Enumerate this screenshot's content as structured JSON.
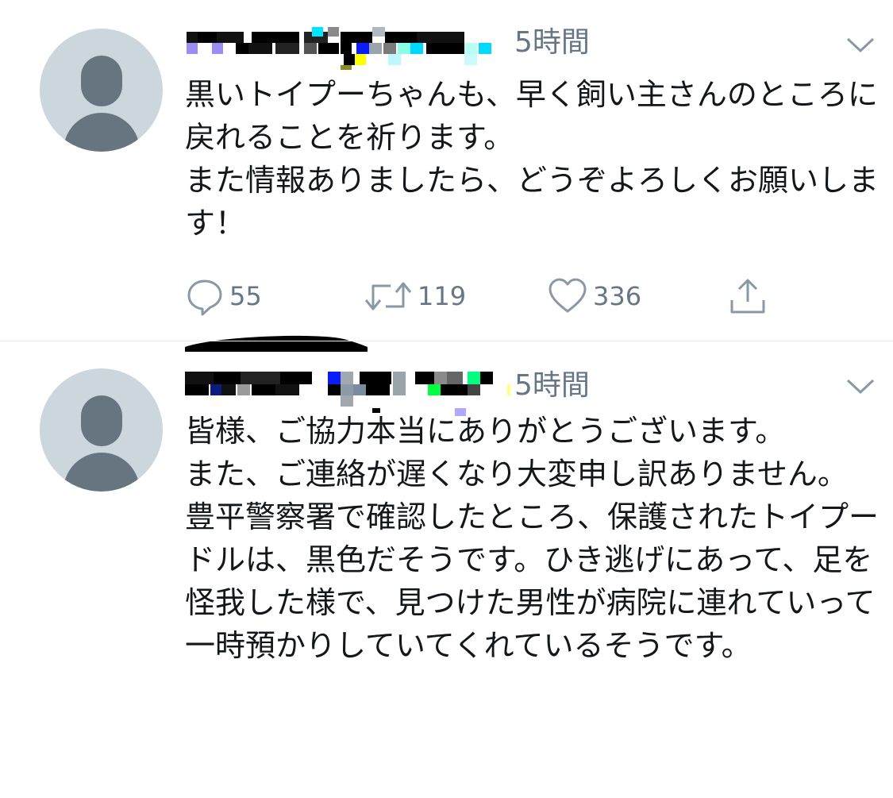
{
  "tweets": [
    {
      "time": "5時間",
      "text": "黒いトイプーちゃんも、早く飼い主さんのところに戻れることを祈ります。\nまた情報ありましたら、どうぞよろしくお願いします！",
      "reply_count": "55",
      "retweet_count": "119",
      "like_count": "336"
    },
    {
      "time": "5時間",
      "text": "皆様、ご協力本当にありがとうございます。\nまた、ご連絡が遅くなり大変申し訳ありません。\n豊平警察署で確認したところ、保護されたトイプードルは、黒色だそうです。ひき逃げにあって、足を怪我した様で、見つけた男性が病院に連れていって一時預かりしていてくれているそうです。"
    }
  ],
  "icons": {
    "reply": "reply-icon",
    "retweet": "retweet-icon",
    "like": "heart-icon",
    "share": "share-icon",
    "caret": "chevron-down-icon",
    "avatar": "default-avatar-icon"
  },
  "colors": {
    "text": "#14171a",
    "secondary": "#657786",
    "avatar_bg": "#ccd6dd",
    "avatar_fg": "#66757f",
    "divider": "#e6ecf0"
  }
}
